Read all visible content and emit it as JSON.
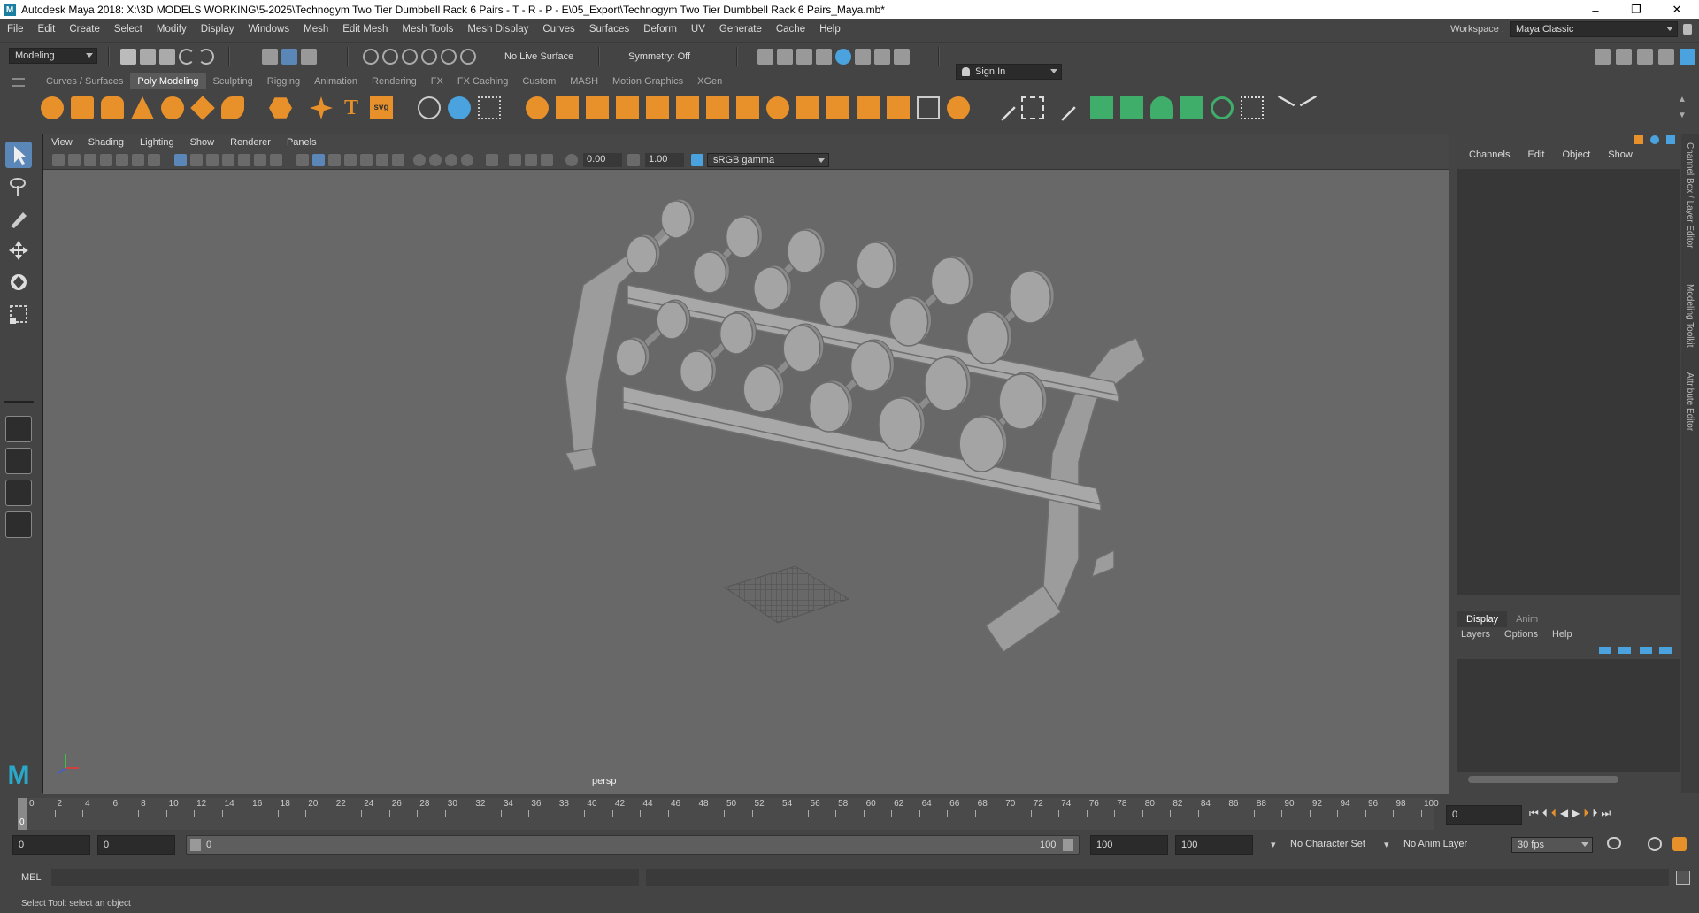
{
  "title": "Autodesk Maya 2018: X:\\3D MODELS WORKING\\5-2025\\Technogym Two Tier Dumbbell Rack 6 Pairs - T - R - P - E\\05_Export\\Technogym Two Tier Dumbbell Rack 6 Pairs_Maya.mb*",
  "window_controls": {
    "minimize": "–",
    "restore": "❐",
    "close": "✕"
  },
  "menus": [
    "File",
    "Edit",
    "Create",
    "Select",
    "Modify",
    "Display",
    "Windows",
    "Mesh",
    "Edit Mesh",
    "Mesh Tools",
    "Mesh Display",
    "Curves",
    "Surfaces",
    "Deform",
    "UV",
    "Generate",
    "Cache",
    "Help"
  ],
  "workspace": {
    "label": "Workspace :",
    "value": "Maya Classic"
  },
  "status": {
    "mode": "Modeling",
    "live_surface": "No Live Surface",
    "symmetry": "Symmetry: Off",
    "sign_in": "Sign In"
  },
  "shelf_tabs": [
    "Curves / Surfaces",
    "Poly Modeling",
    "Sculpting",
    "Rigging",
    "Animation",
    "Rendering",
    "FX",
    "FX Caching",
    "Custom",
    "MASH",
    "Motion Graphics",
    "XGen"
  ],
  "active_shelf_tab": "Poly Modeling",
  "shelf_text_icons": {
    "text": "T",
    "svg": "svg"
  },
  "viewport": {
    "menus": [
      "View",
      "Shading",
      "Lighting",
      "Show",
      "Renderer",
      "Panels"
    ],
    "exposure": "0.00",
    "gamma": "1.00",
    "color_space": "sRGB gamma",
    "camera": "persp"
  },
  "channel_box": {
    "menus": [
      "Channels",
      "Edit",
      "Object",
      "Show"
    ]
  },
  "layer_editor": {
    "tabs": [
      "Display",
      "Anim"
    ],
    "active_tab": "Display",
    "menus": [
      "Layers",
      "Options",
      "Help"
    ]
  },
  "side_tabs": [
    "Channel Box / Layer Editor",
    "Modeling Toolkit",
    "Attribute Editor"
  ],
  "timeline": {
    "ticks": [
      "0",
      "2",
      "4",
      "6",
      "8",
      "10",
      "12",
      "14",
      "16",
      "18",
      "20",
      "22",
      "24",
      "26",
      "28",
      "30",
      "32",
      "34",
      "36",
      "38",
      "40",
      "42",
      "44",
      "46",
      "48",
      "50",
      "52",
      "54",
      "56",
      "58",
      "60",
      "62",
      "64",
      "66",
      "68",
      "70",
      "72",
      "74",
      "76",
      "78",
      "80",
      "82",
      "84",
      "86",
      "88",
      "90",
      "92",
      "94",
      "96",
      "98",
      "100"
    ],
    "current_frame": "0",
    "current_frame_field": "0"
  },
  "range": {
    "start": "0",
    "anim_start": "0",
    "slider_start": "0",
    "slider_end": "100",
    "end": "100",
    "anim_end": "100",
    "character_set": "No Character Set",
    "anim_layer": "No Anim Layer",
    "fps": "30 fps"
  },
  "command_line": {
    "label": "MEL"
  },
  "help_line": "Select Tool: select an object",
  "colors": {
    "accent_orange": "#e8912a",
    "accent_green": "#3fae6a",
    "accent_blue": "#4aa3df",
    "select_active": "#5b87b8"
  }
}
